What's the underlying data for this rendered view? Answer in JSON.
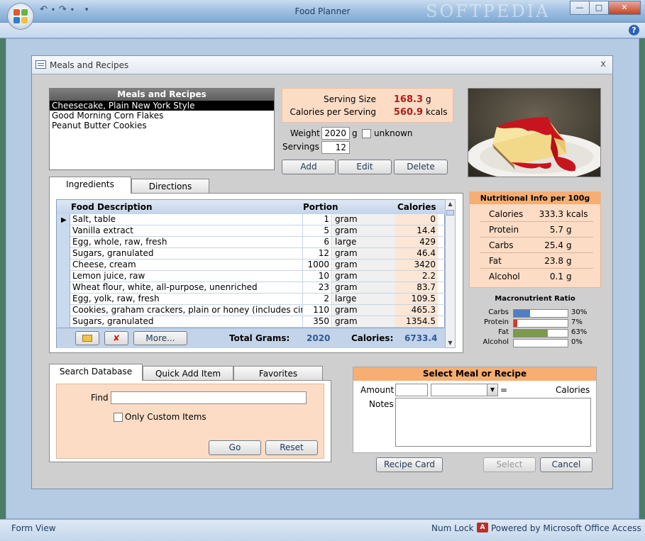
{
  "app": {
    "title": "Food Planner",
    "watermark": "SOFTPEDIA"
  },
  "form": {
    "title": "Meals and Recipes",
    "close": "x"
  },
  "meals": {
    "header": "Meals and Recipes",
    "items": [
      "Cheesecake, Plain New York Style",
      "Good Morning Corn Flakes",
      "Peanut Butter Cookies"
    ]
  },
  "serving": {
    "size_label": "Serving Size",
    "size_value": "168.3",
    "size_unit": "g",
    "cal_label": "Calories per Serving",
    "cal_value": "560.9",
    "cal_unit": "kcals"
  },
  "weight": {
    "label": "Weight",
    "value": "2020",
    "unit": "g",
    "unknown_label": "unknown"
  },
  "servings": {
    "label": "Servings",
    "value": "12"
  },
  "actions": {
    "add": "Add",
    "edit": "Edit",
    "delete": "Delete"
  },
  "tabs_top": {
    "ingredients": "Ingredients",
    "directions": "Directions"
  },
  "grid": {
    "headers": {
      "desc": "Food Description",
      "portion": "Portion",
      "calories": "Calories"
    },
    "rows": [
      {
        "desc": "Salt, table",
        "qty": "1",
        "unit": "gram",
        "cal": "0"
      },
      {
        "desc": "Vanilla extract",
        "qty": "5",
        "unit": "gram",
        "cal": "14.4"
      },
      {
        "desc": "Egg, whole, raw, fresh",
        "qty": "6",
        "unit": "large",
        "cal": "429"
      },
      {
        "desc": "Sugars, granulated",
        "qty": "12",
        "unit": "gram",
        "cal": "46.4"
      },
      {
        "desc": "Cheese, cream",
        "qty": "1000",
        "unit": "gram",
        "cal": "3420"
      },
      {
        "desc": "Lemon juice, raw",
        "qty": "10",
        "unit": "gram",
        "cal": "2.2"
      },
      {
        "desc": "Wheat flour, white, all-purpose, unenriched",
        "qty": "23",
        "unit": "gram",
        "cal": "83.7"
      },
      {
        "desc": "Egg, yolk, raw, fresh",
        "qty": "2",
        "unit": "large",
        "cal": "109.5"
      },
      {
        "desc": "Cookies, graham crackers, plain or honey (includes cinn",
        "qty": "110",
        "unit": "gram",
        "cal": "465.3"
      },
      {
        "desc": "Sugars, granulated",
        "qty": "350",
        "unit": "gram",
        "cal": "1354.5"
      }
    ],
    "more_label": "More...",
    "total_grams_label": "Total Grams:",
    "total_grams": "2020",
    "total_cal_label": "Calories:",
    "total_cal": "6733.4"
  },
  "nutrition": {
    "header": "Nutritional Info per 100g",
    "rows": [
      {
        "label": "Calories",
        "value": "333.3",
        "unit": "kcals"
      },
      {
        "label": "Protein",
        "value": "5.7",
        "unit": "g"
      },
      {
        "label": "Carbs",
        "value": "25.4",
        "unit": "g"
      },
      {
        "label": "Fat",
        "value": "23.8",
        "unit": "g"
      },
      {
        "label": "Alcohol",
        "value": "0.1",
        "unit": "g"
      }
    ]
  },
  "macro": {
    "title": "Macronutrient Ratio",
    "rows": [
      {
        "label": "Carbs",
        "percent": "30%",
        "fraction": 0.3,
        "color": "#4f7fc4"
      },
      {
        "label": "Protein",
        "percent": "7%",
        "fraction": 0.07,
        "color": "#d23b2a"
      },
      {
        "label": "Fat",
        "percent": "63%",
        "fraction": 0.63,
        "color": "#7d9a4a"
      },
      {
        "label": "Alcohol",
        "percent": "0%",
        "fraction": 0.0,
        "color": "#999999"
      }
    ]
  },
  "tabs_bottom": {
    "search": "Search Database",
    "quick": "Quick Add Item",
    "favorites": "Favorites"
  },
  "search": {
    "find_label": "Find",
    "find_value": "",
    "custom_label": "Only Custom Items",
    "go": "Go",
    "reset": "Reset"
  },
  "select_meal": {
    "header": "Select Meal or Recipe",
    "amount_label": "Amount",
    "equals": "=",
    "calories_label": "Calories",
    "notes_label": "Notes"
  },
  "bottom_buttons": {
    "recipe_card": "Recipe Card",
    "select": "Select",
    "cancel": "Cancel"
  },
  "status": {
    "left": "Form View",
    "numlock": "Num Lock",
    "powered": "Powered by Microsoft Office Access"
  }
}
